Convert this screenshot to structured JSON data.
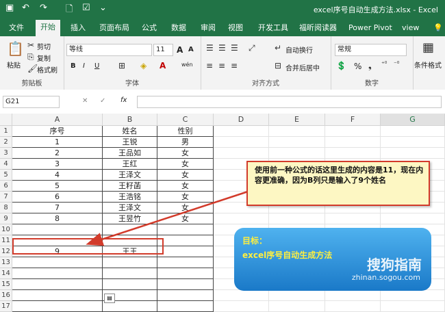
{
  "titlebar": {
    "window_title": "excel序号自动生成方法.xlsx  -  Excel"
  },
  "menu": [
    "文件",
    "开始",
    "插入",
    "页面布局",
    "公式",
    "数据",
    "审阅",
    "视图",
    "开发工具",
    "福昕阅读器",
    "Power Pivot",
    "view"
  ],
  "active_tab_index": 1,
  "ribbon": {
    "clipboard": {
      "paste": "粘贴",
      "cut": "剪切",
      "copy": "复制",
      "format_painter": "格式刷",
      "label": "剪贴板"
    },
    "font": {
      "name": "等线",
      "size": "11",
      "bold": "B",
      "italic": "I",
      "underline": "U",
      "label": "字体",
      "grow": "A",
      "shrink": "A",
      "pinyin": "wén"
    },
    "alignment": {
      "wrap": "自动换行",
      "merge": "合并后居中",
      "label": "对齐方式"
    },
    "number": {
      "format": "常规",
      "label": "数字",
      "percent": "%"
    },
    "styles": {
      "conditional": "条件格式"
    }
  },
  "formula_bar": {
    "name_box": "G21",
    "fx": "fx",
    "cancel": "✕",
    "enter": "✓"
  },
  "sheet": {
    "columns": [
      "A",
      "B",
      "C",
      "D",
      "E",
      "F",
      "G"
    ],
    "rows": [
      [
        "序号",
        "姓名",
        "性别"
      ],
      [
        "1",
        "王锐",
        "男"
      ],
      [
        "2",
        "王品如",
        "女"
      ],
      [
        "3",
        "王红",
        "女"
      ],
      [
        "4",
        "王泽文",
        "女"
      ],
      [
        "5",
        "王籽菡",
        "女"
      ],
      [
        "6",
        "王浩铭",
        "女"
      ],
      [
        "7",
        "王泽文",
        "女"
      ],
      [
        "8",
        "王昱竹",
        "女"
      ],
      [
        "",
        "",
        ""
      ],
      [
        "",
        "",
        ""
      ],
      [
        "9",
        "王王",
        ""
      ],
      [
        "",
        "",
        ""
      ],
      [
        "",
        "",
        ""
      ],
      [
        "",
        "",
        ""
      ],
      [
        "",
        "",
        ""
      ],
      [
        "",
        "",
        ""
      ]
    ],
    "row_numbers": [
      "1",
      "2",
      "3",
      "4",
      "5",
      "6",
      "7",
      "8",
      "9",
      "10",
      "11",
      "12",
      "13",
      "14",
      "15",
      "16",
      "17"
    ]
  },
  "annotation": {
    "callout_text": "使用前一种公式的话这里生成的内容是11，现在内容更准确，因为B列只是输入了9个姓名",
    "goal_title": "目标：",
    "goal_text": "excel序号自动生成方法",
    "watermark": "搜狗指南",
    "watermark_url": "zhinan.sogou.com"
  },
  "colors": {
    "excel_green": "#217346",
    "callout_border": "#d23b2b",
    "callout_fill": "#fdf7c3",
    "goal_blue": "#2a8bd9",
    "goal_text": "#ffef3f"
  }
}
